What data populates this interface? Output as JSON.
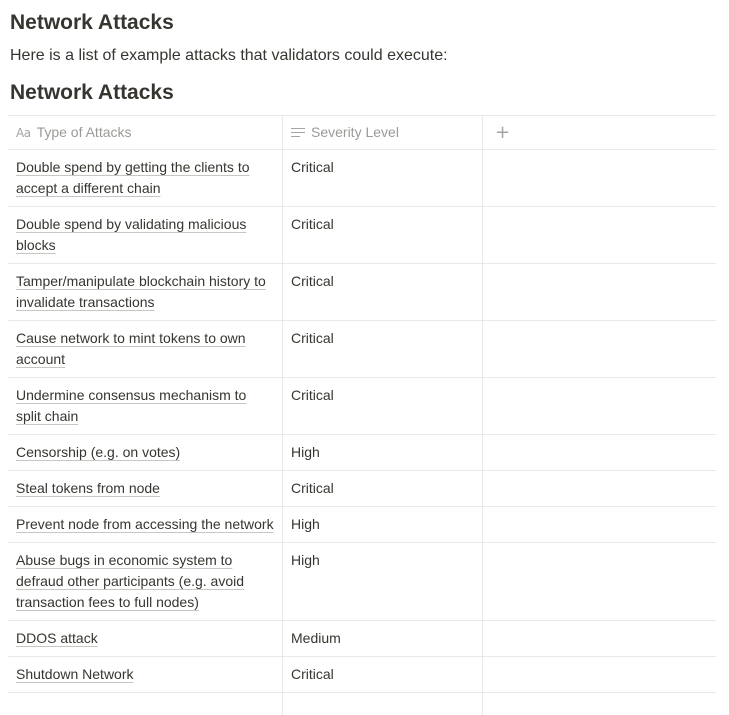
{
  "page": {
    "heading": "Network Attacks",
    "intro": "Here is a list of example attacks that validators could execute:"
  },
  "database": {
    "title": "Network Attacks",
    "columns": [
      {
        "label": "Type of Attacks",
        "icon": "title-aa-icon"
      },
      {
        "label": "Severity Level",
        "icon": "text-lines-icon"
      },
      {
        "label": "",
        "icon": "plus-icon"
      }
    ],
    "rows": [
      {
        "attack": "Double spend by getting the clients to accept a different chain",
        "severity": "Critical"
      },
      {
        "attack": "Double spend by validating malicious blocks",
        "severity": "Critical"
      },
      {
        "attack": "Tamper/manipulate blockchain history to invalidate transactions",
        "severity": "Critical"
      },
      {
        "attack": "Cause network to mint tokens to own account",
        "severity": "Critical"
      },
      {
        "attack": "Undermine consensus mechanism to split chain",
        "severity": "Critical"
      },
      {
        "attack": "Censorship (e.g. on votes)",
        "severity": "High"
      },
      {
        "attack": "Steal tokens from node",
        "severity": "Critical"
      },
      {
        "attack": "Prevent node from accessing the network",
        "severity": "High"
      },
      {
        "attack": "Abuse bugs in economic system to defraud other participants (e.g. avoid transaction fees to full nodes)",
        "severity": "High"
      },
      {
        "attack": "DDOS attack",
        "severity": "Medium"
      },
      {
        "attack": "Shutdown Network",
        "severity": "Critical"
      }
    ]
  }
}
